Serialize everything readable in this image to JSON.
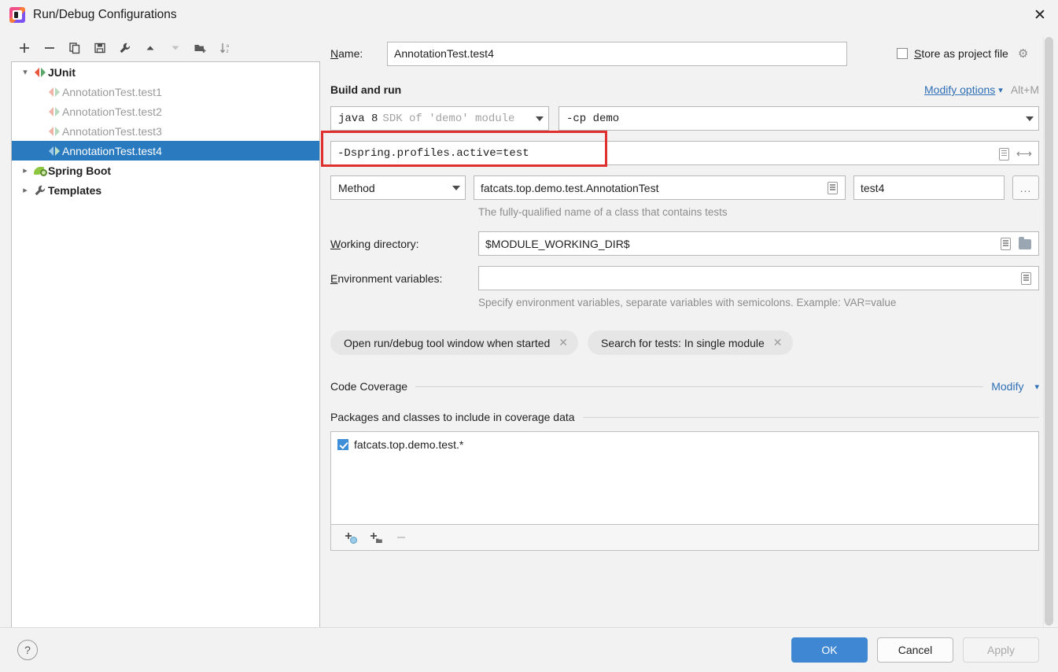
{
  "window": {
    "title": "Run/Debug Configurations",
    "close_label": "✕",
    "app_icon": "intellij-idea-icon"
  },
  "tree_toolbar": [
    {
      "name": "add-configuration-button",
      "glyph": "＋"
    },
    {
      "name": "remove-configuration-button",
      "glyph": "−"
    },
    {
      "name": "copy-configuration-button",
      "glyph": "⧉"
    },
    {
      "name": "save-configuration-button",
      "glyph": "Ὃe"
    },
    {
      "name": "edit-templates-button",
      "glyph": "ὒ7"
    },
    {
      "name": "move-up-button",
      "glyph": "▲"
    },
    {
      "name": "move-down-button",
      "glyph": "▼"
    },
    {
      "name": "new-folder-button",
      "glyph": "Ὄ1"
    },
    {
      "name": "sort-configurations-button",
      "glyph": "↓"
    }
  ],
  "tree": {
    "nodes": [
      {
        "label": "JUnit",
        "icon": "junit-icon",
        "expanded": true,
        "bold": true,
        "level": 0,
        "selected": false,
        "has_chevron": true
      },
      {
        "label": "AnnotationTest.test1",
        "icon": "junit-icon-faded",
        "level": 1,
        "selected": false,
        "has_chevron": false,
        "dim": true
      },
      {
        "label": "AnnotationTest.test2",
        "icon": "junit-icon-faded",
        "level": 1,
        "selected": false,
        "has_chevron": false,
        "dim": true
      },
      {
        "label": "AnnotationTest.test3",
        "icon": "junit-icon-faded",
        "level": 1,
        "selected": false,
        "has_chevron": false,
        "dim": true
      },
      {
        "label": "AnnotationTest.test4",
        "icon": "junit-icon-faded",
        "level": 1,
        "selected": true,
        "has_chevron": false,
        "dim": false
      },
      {
        "label": "Spring Boot",
        "icon": "spring-boot-icon",
        "expanded": false,
        "bold": true,
        "level": 0,
        "selected": false,
        "has_chevron": true
      },
      {
        "label": "Templates",
        "icon": "wrench-icon",
        "expanded": false,
        "bold": true,
        "level": 0,
        "selected": false,
        "has_chevron": true
      }
    ]
  },
  "form": {
    "name_label": "Name:",
    "name_mnemonic": "N",
    "name_value": "AnnotationTest.test4",
    "store_as_project_file_label": "Store as project file",
    "store_as_project_file_mnemonic": "S",
    "store_as_project_file_checked": false,
    "gear_icon": "gear-icon",
    "section_build_and_run": "Build and run",
    "modify_options_label": "Modify options",
    "modify_options_mnemonic": "M",
    "modify_options_shortcut": "Alt+M",
    "sdk_value_prefix": "java 8",
    "sdk_value_suffix": "SDK of 'demo' module",
    "classpath_value": "-cp demo",
    "vm_options_value": "-Dspring.profiles.active=test",
    "target_kind": "Method",
    "class_value": "fatcats.top.demo.test.AnnotationTest",
    "method_value": "test4",
    "ellipsis_label": "...",
    "class_hint": "The fully-qualified name of a class that contains tests",
    "working_directory_label": "Working directory:",
    "working_directory_mnemonic": "W",
    "working_directory_value": "$MODULE_WORKING_DIR$",
    "environment_variables_label": "Environment variables:",
    "environment_variables_mnemonic": "E",
    "environment_variables_value": "",
    "environment_hint": "Specify environment variables, separate variables with semicolons. Example: VAR=value",
    "chips": [
      {
        "label": "Open run/debug tool window when started",
        "close": "✕"
      },
      {
        "label": "Search for tests: In single module",
        "close": "✕"
      }
    ],
    "section_code_coverage": "Code Coverage",
    "coverage_modify_label": "Modify",
    "packages_header": "Packages and classes to include in coverage data",
    "coverage_items": [
      {
        "label": "fatcats.top.demo.test.*",
        "checked": true
      }
    ],
    "coverage_toolbar": [
      {
        "name": "add-class-pattern-button",
        "glyph": "+"
      },
      {
        "name": "add-package-pattern-button",
        "glyph": "+"
      },
      {
        "name": "remove-pattern-button",
        "glyph": "−"
      }
    ]
  },
  "footer": {
    "help_label": "?",
    "ok_label": "OK",
    "cancel_label": "Cancel",
    "apply_label": "Apply",
    "apply_enabled": false
  },
  "annotation": {
    "highlight_color": "#e02f2f",
    "target": "vm-options-field"
  },
  "colors": {
    "selection_blue": "#2a7ac0",
    "link_blue": "#2f6fb5",
    "primary_button": "#3f87d2",
    "annotation_red": "#e02f2f"
  }
}
